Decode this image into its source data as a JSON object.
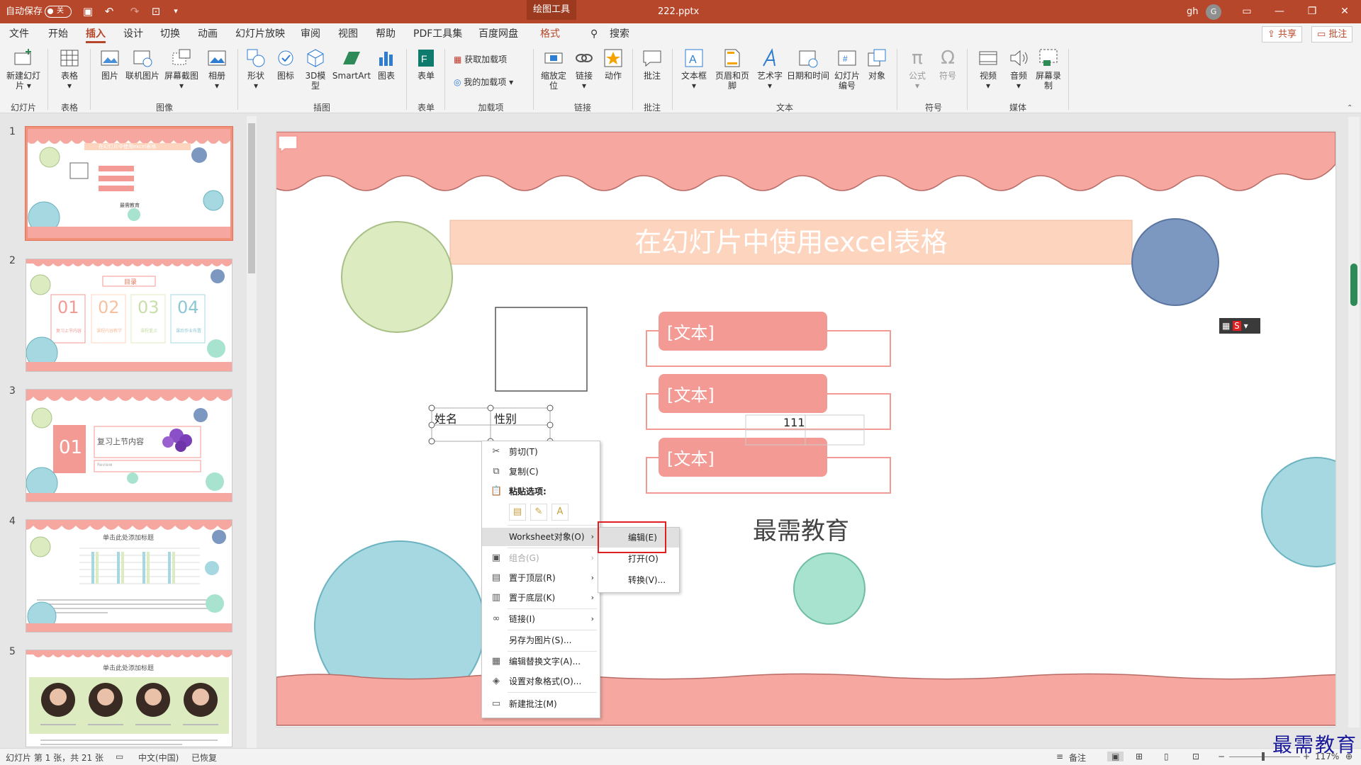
{
  "titlebar": {
    "autosave": "自动保存",
    "toggle": "关",
    "context_tab": "绘图工具",
    "filename": "222.pptx",
    "user": "gh",
    "avatar": "G"
  },
  "menu": {
    "items": [
      "文件",
      "开始",
      "插入",
      "设计",
      "切换",
      "动画",
      "幻灯片放映",
      "审阅",
      "视图",
      "帮助",
      "PDF工具集",
      "百度网盘",
      "格式"
    ],
    "search": "搜索",
    "share": "共享",
    "comment": "批注"
  },
  "ribbon": {
    "new_slide": "新建幻灯片",
    "table": "表格",
    "picture": "图片",
    "online_picture": "联机图片",
    "screenshot": "屏幕截图",
    "album": "相册",
    "shapes": "形状",
    "icons": "图标",
    "model3d": "3D模型",
    "smartart": "SmartArt",
    "chart": "图表",
    "form": "表单",
    "get_addins": "获取加载项",
    "my_addins": "我的加载项",
    "zoom": "缩放定位",
    "link": "链接",
    "action": "动作",
    "comment": "批注",
    "textbox": "文本框",
    "header_footer": "页眉和页脚",
    "wordart": "艺术字",
    "datetime": "日期和时间",
    "slide_number": "幻灯片编号",
    "object": "对象",
    "equation": "公式",
    "symbol": "符号",
    "video": "视频",
    "audio": "音频",
    "screen_record": "屏幕录制",
    "groups": {
      "slides": "幻灯片",
      "tables": "表格",
      "images": "图像",
      "illustrations": "插图",
      "forms": "表单",
      "addins": "加载项",
      "links": "链接",
      "comments": "批注",
      "text": "文本",
      "symbols": "符号",
      "media": "媒体"
    }
  },
  "thumbnails": [
    {
      "num": "1",
      "title": "在幻灯片中使用excel表格",
      "footer": "最需教育"
    },
    {
      "num": "2",
      "title": "目录",
      "items": [
        "01",
        "02",
        "03",
        "04"
      ],
      "subs": [
        "复习上节内容",
        "课程内容教学",
        "课程重点",
        "课后作业布置"
      ]
    },
    {
      "num": "3",
      "badge": "01",
      "text": "复习上节内容",
      "sub": "Review"
    },
    {
      "num": "4",
      "title": "单击此处添加标题"
    },
    {
      "num": "5",
      "title": "单击此处添加标题"
    }
  ],
  "slide": {
    "title": "在幻灯片中使用excel表格",
    "text_placeholder": "[文本]",
    "table_cells": [
      "姓名",
      "性别"
    ],
    "cell_value": "111",
    "footer": "最需教育"
  },
  "context_menu": {
    "items": [
      {
        "label": "剪切(T)",
        "icon": "✂"
      },
      {
        "label": "复制(C)",
        "icon": "⧉"
      },
      {
        "label": "粘贴选项:",
        "icon": "📋"
      },
      {
        "label": "Worksheet对象(O)",
        "icon": ""
      },
      {
        "label": "组合(G)",
        "icon": "▣"
      },
      {
        "label": "置于顶层(R)",
        "icon": "▤"
      },
      {
        "label": "置于底层(K)",
        "icon": "▥"
      },
      {
        "label": "链接(I)",
        "icon": "∞"
      },
      {
        "label": "另存为图片(S)...",
        "icon": ""
      },
      {
        "label": "编辑替换文字(A)...",
        "icon": "▦"
      },
      {
        "label": "设置对象格式(O)...",
        "icon": "◈"
      },
      {
        "label": "新建批注(M)",
        "icon": "▭"
      }
    ],
    "submenu": [
      "编辑(E)",
      "打开(O)",
      "转换(V)..."
    ]
  },
  "status": {
    "slide_info": "幻灯片 第 1 张，共 21 张",
    "language": "中文(中国)",
    "recovered": "已恢复",
    "notes": "备注",
    "zoom": "117%"
  },
  "watermark": "最需教育",
  "colors": {
    "accent": "#b7472a",
    "scallop": "#f5a7a0",
    "title_bar": "#fdd4bd",
    "text_box": "#f39a95"
  }
}
